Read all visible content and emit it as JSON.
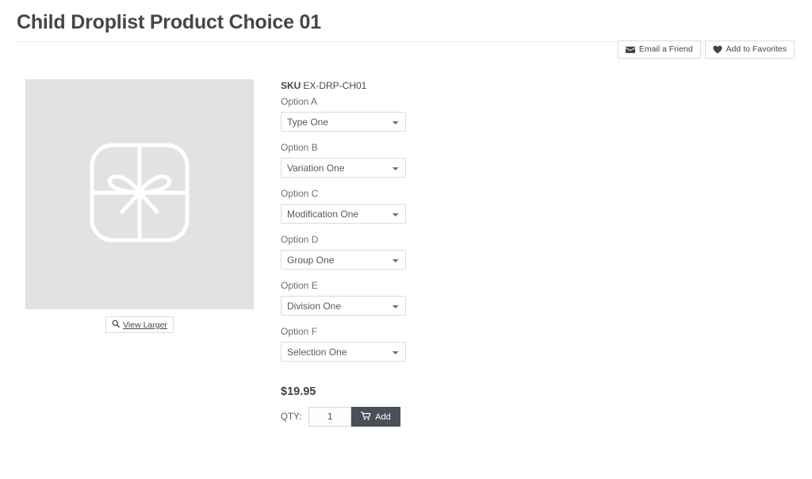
{
  "header": {
    "title": "Child Droplist Product Choice 01"
  },
  "actions": {
    "email_friend": {
      "label": "Email a Friend",
      "icon": "envelope-icon"
    },
    "add_favorites": {
      "label": "Add to Favorites",
      "icon": "heart-icon"
    }
  },
  "media": {
    "placeholder_icon": "gift-box-icon",
    "view_larger_label": "View Larger",
    "view_larger_icon": "magnifier-icon"
  },
  "product": {
    "sku_label": "SKU",
    "sku_value": "EX-DRP-CH01",
    "options": [
      {
        "label": "Option A",
        "value": "Type One"
      },
      {
        "label": "Option B",
        "value": "Variation One"
      },
      {
        "label": "Option C",
        "value": "Modification One"
      },
      {
        "label": "Option D",
        "value": "Group One"
      },
      {
        "label": "Option E",
        "value": "Division One"
      },
      {
        "label": "Option F",
        "value": "Selection One"
      }
    ],
    "price": "$19.95",
    "qty_label": "QTY:",
    "qty_value": "1",
    "add_label": "Add",
    "add_icon": "cart-icon"
  },
  "colors": {
    "text": "#44474b",
    "muted": "#6b6f73",
    "add_button": "#4b5058",
    "image_placeholder": "#e2e2e2",
    "border": "#dddddd"
  }
}
